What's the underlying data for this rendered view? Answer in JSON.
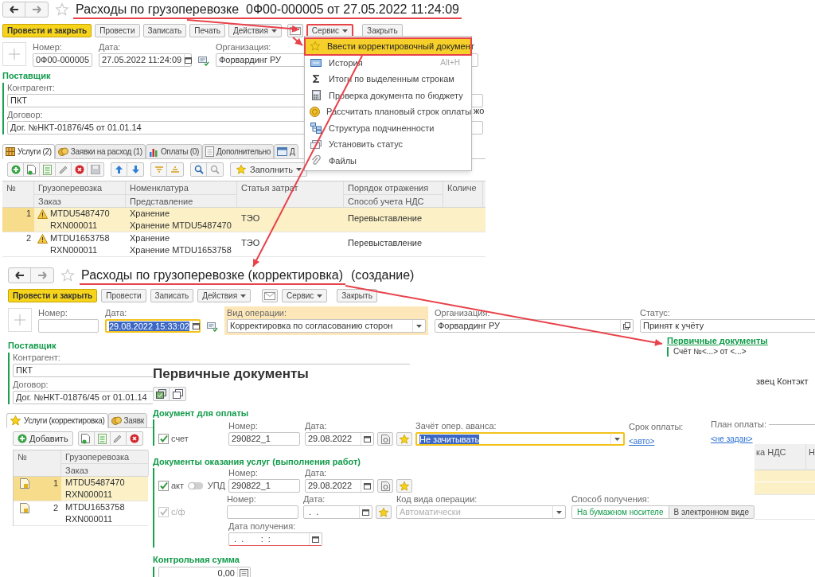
{
  "top_form": {
    "title": "Расходы по грузоперевозке  0Ф00-000005 от 27.05.2022 11:24:09",
    "toolbar": [
      {
        "kind": "primary",
        "label": "Провести и закрыть",
        "highlighted": false
      },
      {
        "kind": "plain",
        "label": "Провести",
        "highlighted": false
      },
      {
        "kind": "plain",
        "label": "Записать",
        "highlighted": false
      },
      {
        "kind": "plain",
        "label": "Печать",
        "highlighted": false
      },
      {
        "kind": "menu",
        "label": "Действия",
        "highlighted": false
      },
      {
        "kind": "mail",
        "highlighted": false
      },
      {
        "kind": "menu",
        "label": "Сервис",
        "highlighted": true
      },
      {
        "kind": "plain",
        "label": "Закрыть",
        "highlighted": false
      }
    ],
    "header_fields": [
      {
        "label": "Номер:",
        "value": "0Ф00-000005",
        "kind": "text",
        "focused": false,
        "highlighted": false
      },
      {
        "label": "Дата:",
        "value": "27.05.2022 11:24:09",
        "kind": "date",
        "focused": false,
        "highlighted": false
      },
      {
        "label": "Организация:",
        "value": "Форвардинг РУ",
        "kind": "text",
        "focused": false,
        "highlighted": false
      }
    ],
    "supplier": {
      "title": "Поставщик",
      "contractor_label": "Контрагент:",
      "contractor": "ПКТ",
      "contract_label": "Договор:",
      "contract": "Дог. №НКТ-01876/45 от 01.01.14"
    },
    "side_fragment": "жо",
    "tabs": [
      {
        "label": "Услуги (2)",
        "kind": "grid",
        "selected": true
      },
      {
        "label": "Заявки на расход (1)",
        "kind": "coins",
        "selected": false
      },
      {
        "label": "Оплаты (0)",
        "kind": "chart",
        "selected": false
      },
      {
        "label": "Дополнительно",
        "kind": "page",
        "selected": false
      },
      {
        "label": "Д",
        "kind": "form",
        "selected": false
      }
    ],
    "fill_label": "Заполнить",
    "table": {
      "columns": [
        {
          "top": "№"
        },
        {
          "top": "Грузоперевозка",
          "bottom": "Заказ"
        },
        {
          "top": "Номенклатура",
          "bottom": "Представление"
        },
        {
          "top": "Статья затрат"
        },
        {
          "top": "Порядок отражения",
          "bottom": "Способ учета НДС"
        },
        {
          "top": "Количе"
        }
      ],
      "rows": [
        {
          "n": "1",
          "warning": true,
          "selected": true,
          "shipment": "MTDU5487470",
          "order": "RXN000011",
          "item": "Хранение",
          "description": "Хранение MTDU5487470",
          "cost_item": "ТЭО",
          "reflection": "Перевыставление"
        },
        {
          "n": "2",
          "warning": true,
          "selected": false,
          "shipment": "MTDU1653758",
          "order": "RXN000011",
          "item": "Хранение",
          "description": "Хранение MTDU1653758",
          "cost_item": "ТЭО",
          "reflection": "Перевыставление"
        }
      ]
    }
  },
  "menu": {
    "items": [
      {
        "label": "Ввести корректировочный документ",
        "kind": "star",
        "selected": true,
        "highlighted": true
      },
      {
        "label": "История",
        "shortcut": "Alt+H",
        "kind": "history",
        "selected": false,
        "highlighted": false
      },
      {
        "label": "Итоги по выделенным строкам",
        "kind": "sum",
        "selected": false,
        "highlighted": false
      },
      {
        "label": "Проверка документа по бюджету",
        "kind": "calc",
        "selected": false,
        "highlighted": false
      },
      {
        "label": "Рассчитать плановый строк оплаты",
        "kind": "coin",
        "selected": false,
        "highlighted": false
      },
      {
        "label": "Структура подчиненности",
        "kind": "tree",
        "selected": false,
        "highlighted": false
      },
      {
        "label": "Установить статус",
        "kind": "status",
        "selected": false,
        "highlighted": false
      },
      {
        "label": "Файлы",
        "kind": "clip",
        "selected": false,
        "highlighted": false
      }
    ]
  },
  "correction_form": {
    "title": "Расходы по грузоперевозке (корректировка)",
    "title_suffix": "(создание)",
    "toolbar": [
      {
        "kind": "primary",
        "label": "Провести и закрыть"
      },
      {
        "kind": "plain",
        "label": "Провести"
      },
      {
        "kind": "plain",
        "label": "Записать"
      },
      {
        "kind": "menu",
        "label": "Действия"
      },
      {
        "kind": "mail"
      },
      {
        "kind": "menu",
        "label": "Сервис"
      },
      {
        "kind": "plain",
        "label": "Закрыть"
      }
    ],
    "header_fields": [
      {
        "label": "Номер:",
        "kind": "text",
        "focused": false,
        "highlighted": false
      },
      {
        "label": "Дата:",
        "value": "29.08.2022 15:33:02",
        "kind": "date",
        "focused": true,
        "highlighted": false
      },
      {
        "label": "Вид операции:",
        "value": "Корректировка по согласованию сторон",
        "kind": "select",
        "focused": false,
        "highlighted": true
      },
      {
        "label": "Организация:",
        "value": "Форвардинг РУ",
        "kind": "open",
        "focused": false,
        "highlighted": false
      },
      {
        "label": "Статус:",
        "value": "Принят к учёту",
        "kind": "text",
        "focused": false,
        "highlighted": false
      }
    ],
    "supplier": {
      "title": "Поставщик",
      "contractor_label": "Контрагент:",
      "contractor": "ПКТ",
      "contract_label": "Договор:",
      "contract": "Дог. №НКТ-01876/45 от 01.01.14"
    },
    "primary_docs_link": "Первичные документы",
    "primary_docs_summary": "Счёт №<...> от <...>",
    "side_fragment": "звец Контэкт",
    "tabs": [
      {
        "label": "Услуги (корректировка)",
        "kind": "star",
        "selected": true
      },
      {
        "label": "Заявк",
        "kind": "coins",
        "selected": false
      }
    ],
    "add_label": "Добавить",
    "table": {
      "columns": [
        {
          "top": "№"
        },
        {
          "top": "Грузоперевозка",
          "bottom": "Заказ"
        }
      ],
      "right_columns": [
        "ка НДС",
        "Н"
      ],
      "rows": [
        {
          "n": "1",
          "shipment": "MTDU5487470",
          "order": "RXN000011",
          "selected": true
        },
        {
          "n": "2",
          "shipment": "MTDU1653758",
          "order": "RXN000011",
          "selected": false
        }
      ]
    }
  },
  "dialog": {
    "title": "Первичные документы",
    "payment_section": "Документ для оплаты",
    "invoice": {
      "label": "счет",
      "checked": true,
      "number_label": "Номер:",
      "number": "290822_1",
      "date_label": "Дата:",
      "date": "29.08.2022"
    },
    "advance": {
      "label": "Зачёт опер. аванса:",
      "value": "Не зачитывать",
      "focused": true
    },
    "due": {
      "label": "Срок оплаты:",
      "link": "<авто>"
    },
    "plan": {
      "label": "План оплаты:",
      "link": "<не задан>"
    },
    "services_section": "Документы оказания услуг (выполнения работ)",
    "act": {
      "label": "акт",
      "checked": true,
      "switch_on": false,
      "switch_label": "УПД",
      "number_label": "Номер:",
      "number": "290822_1",
      "date_label": "Дата:",
      "date": "29.08.2022"
    },
    "sf": {
      "label": "с/ф",
      "checked": true,
      "disabled": true,
      "number_label": "Номер:",
      "date_label": "Дата:",
      "date": " .  .",
      "op_code_label": "Код вида операции:",
      "op_code_placeholder": "Автоматически",
      "receipt_label": "Способ получения:",
      "receipt_options": [
        {
          "label": "На бумажном носителе",
          "selected": true
        },
        {
          "label": "В электронном виде",
          "selected": false
        }
      ]
    },
    "received": {
      "label": "Дата получения:",
      "value": " .  .       :  :"
    },
    "checksum_section": "Контрольная сумма",
    "checksum": "0,00"
  }
}
